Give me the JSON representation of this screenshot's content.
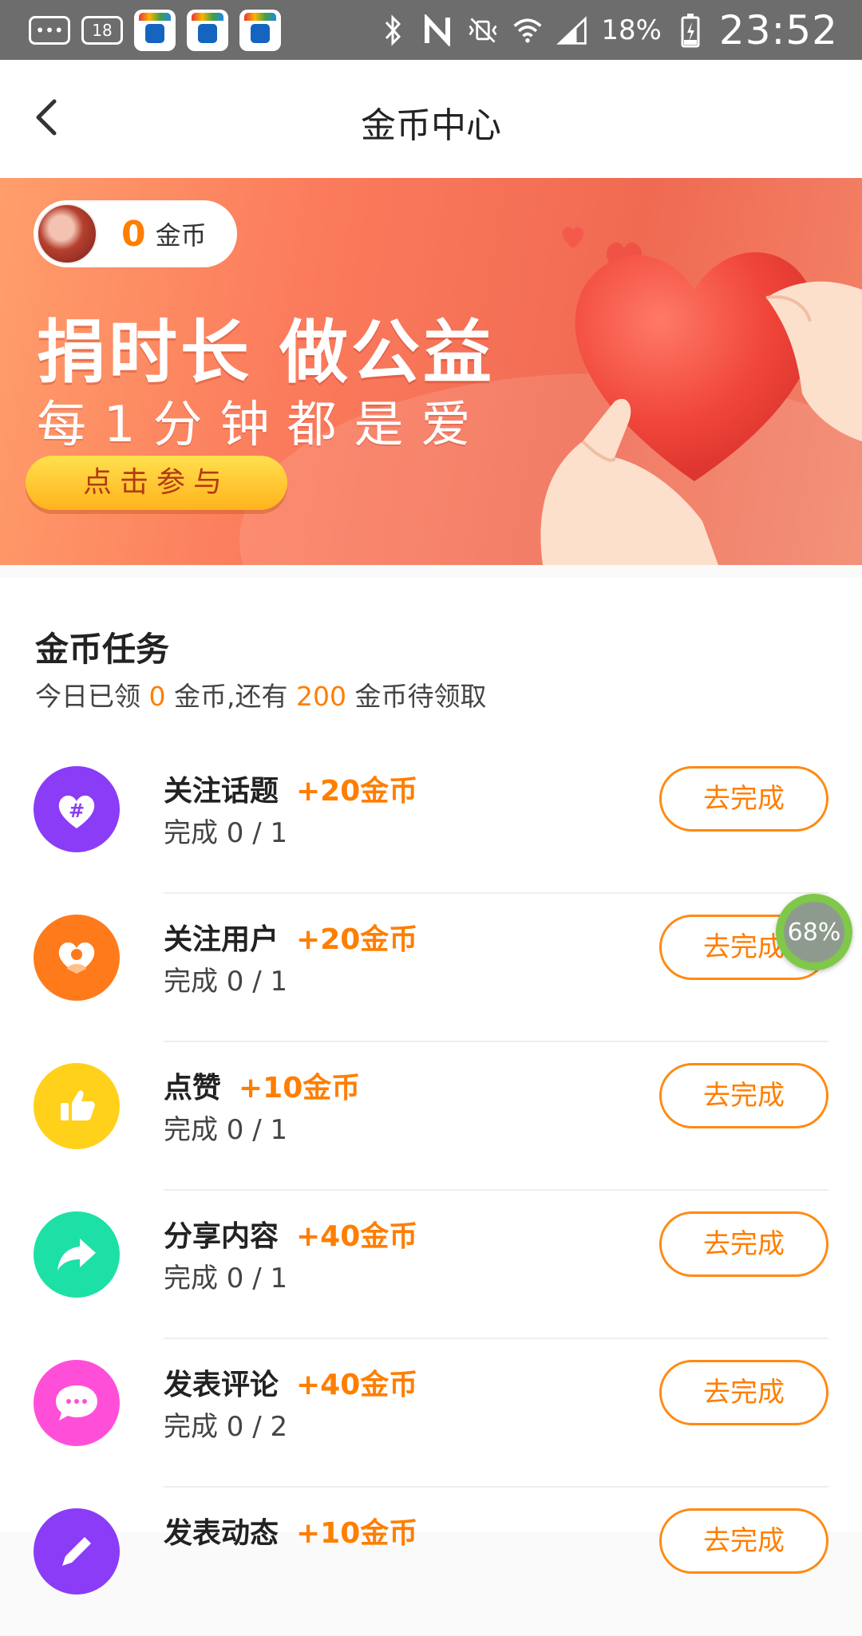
{
  "status_bar": {
    "notif_count": "18",
    "battery": "18%",
    "time": "23:52"
  },
  "header": {
    "title": "金币中心"
  },
  "banner": {
    "coins": "0",
    "coin_unit": "金币",
    "headline": "捐时长 做公益",
    "subline": "每1分钟都是爱",
    "button_label": "点击参与"
  },
  "tasks_section": {
    "title": "金币任务",
    "summary": {
      "prefix": "今日已领",
      "claimed": "0",
      "middle": "金币,还有",
      "pending": "200",
      "suffix": "金币待领取"
    }
  },
  "tasks": [
    {
      "name": "关注话题",
      "reward": "+20金币",
      "progress": "完成 0 / 1",
      "button": "去完成",
      "icon": "hashtag-heart-icon",
      "color": "#8b3cf7"
    },
    {
      "name": "关注用户",
      "reward": "+20金币",
      "progress": "完成 0 / 1",
      "button": "去完成",
      "icon": "user-heart-icon",
      "color": "#ff7a1a"
    },
    {
      "name": "点赞",
      "reward": "+10金币",
      "progress": "完成 0 / 1",
      "button": "去完成",
      "icon": "thumbs-up-icon",
      "color": "#ffd11a"
    },
    {
      "name": "分享内容",
      "reward": "+40金币",
      "progress": "完成 0 / 1",
      "button": "去完成",
      "icon": "share-arrow-icon",
      "color": "#1de0a6"
    },
    {
      "name": "发表评论",
      "reward": "+40金币",
      "progress": "完成 0 / 2",
      "button": "去完成",
      "icon": "comment-bubble-icon",
      "color": "#ff4fd8"
    },
    {
      "name": "发表动态",
      "reward": "+10金币",
      "progress": "",
      "button": "去完成",
      "icon": "pencil-icon",
      "color": "#8b3cf7"
    }
  ],
  "floating_ball": {
    "label": "68%"
  }
}
